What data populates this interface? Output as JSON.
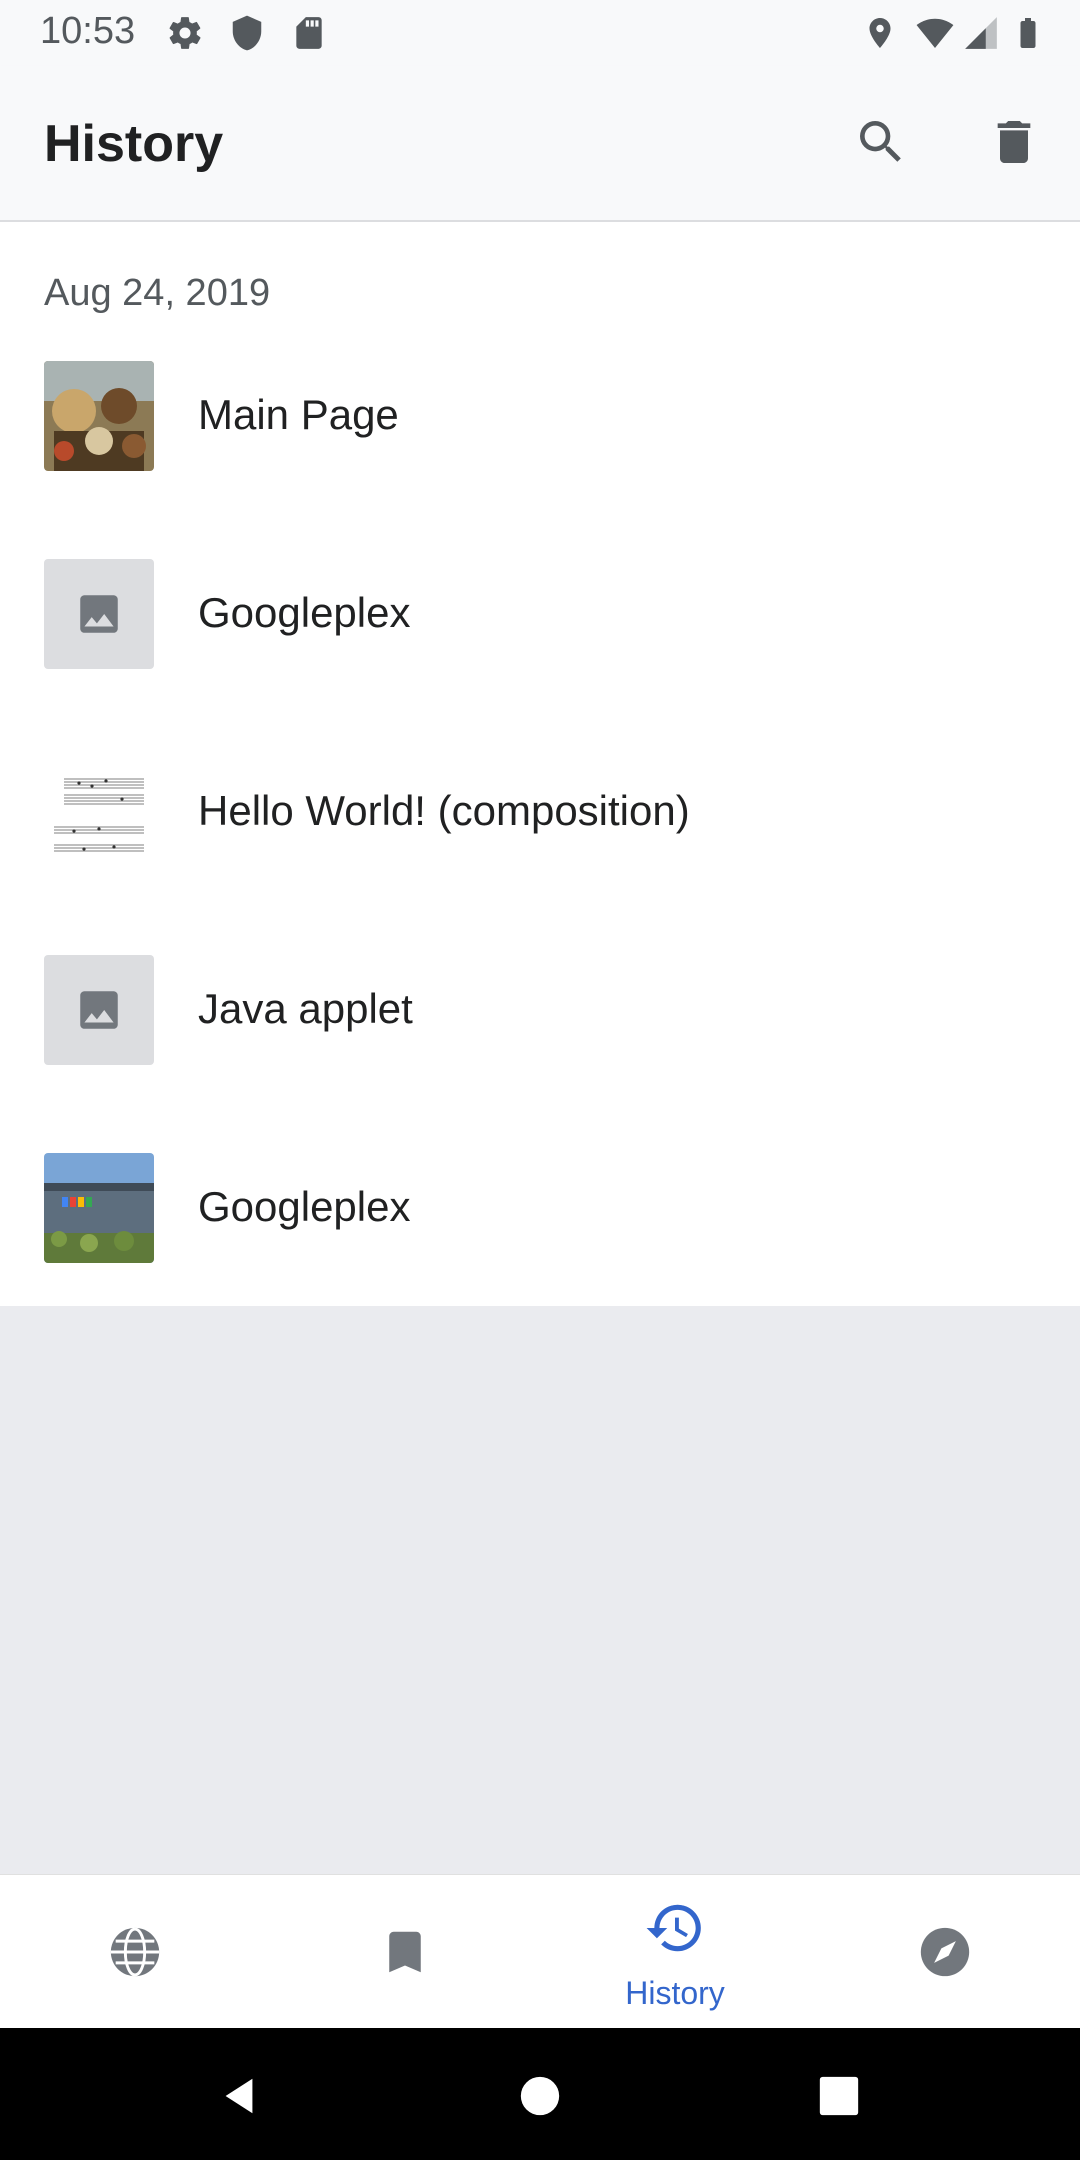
{
  "status_bar": {
    "time": "10:53",
    "left_icons": [
      "settings-icon",
      "shield-icon",
      "sd-card-icon"
    ],
    "right_icons": [
      "location-icon",
      "wifi-icon",
      "signal-icon",
      "battery-icon"
    ]
  },
  "app_bar": {
    "title": "History",
    "actions": [
      "search-icon",
      "delete-icon"
    ]
  },
  "history": {
    "date": "Aug 24, 2019",
    "items": [
      {
        "title": "Main Page",
        "thumbnail": "painting"
      },
      {
        "title": "Googleplex",
        "thumbnail": "placeholder"
      },
      {
        "title": "Hello World! (composition)",
        "thumbnail": "sheet-music"
      },
      {
        "title": "Java applet",
        "thumbnail": "placeholder"
      },
      {
        "title": "Googleplex",
        "thumbnail": "building-photo"
      }
    ]
  },
  "bottom_nav": {
    "items": [
      {
        "icon": "globe-icon",
        "label": ""
      },
      {
        "icon": "bookmark-icon",
        "label": ""
      },
      {
        "icon": "history-icon",
        "label": "History",
        "active": true
      },
      {
        "icon": "compass-icon",
        "label": ""
      }
    ]
  },
  "colors": {
    "accent": "#3366cc",
    "icon_gray": "#54595d",
    "background": "#eaebef"
  }
}
